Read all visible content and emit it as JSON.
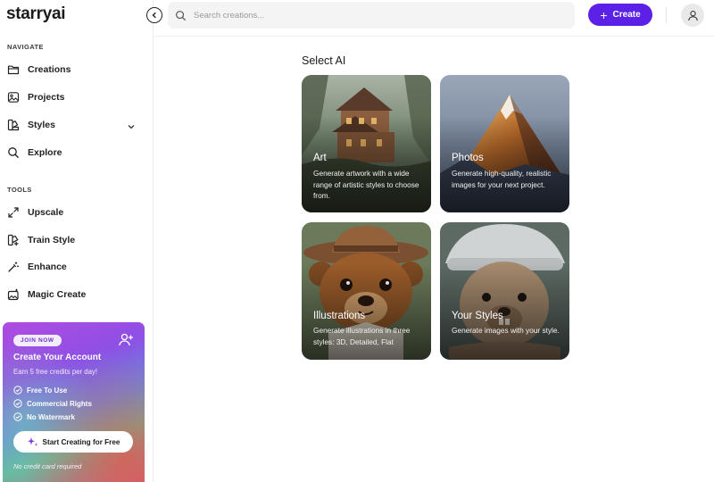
{
  "brand": {
    "logo": "starryai"
  },
  "sidebar": {
    "navigate_label": "NAVIGATE",
    "navigate_items": [
      {
        "label": "Creations",
        "icon": "folder-icon"
      },
      {
        "label": "Projects",
        "icon": "image-icon"
      },
      {
        "label": "Styles",
        "icon": "palette-icon"
      },
      {
        "label": "Explore",
        "icon": "search-icon"
      }
    ],
    "tools_label": "TOOLS",
    "tool_items": [
      {
        "label": "Upscale",
        "icon": "expand-icon"
      },
      {
        "label": "Train Style",
        "icon": "train-icon"
      },
      {
        "label": "Enhance",
        "icon": "wand-icon"
      },
      {
        "label": "Magic Create",
        "icon": "magic-image-icon"
      }
    ]
  },
  "promo": {
    "pill": "JOIN NOW",
    "title": "Create Your Account",
    "subtitle": "Earn 5 free credits per day!",
    "perks": [
      "Free To Use",
      "Commercial Rights",
      "No Watermark"
    ],
    "cta": "Start Creating for Free",
    "footnote": "No credit card required"
  },
  "topbar": {
    "search_placeholder": "Search creations...",
    "create_label": "Create"
  },
  "main": {
    "title": "Select AI",
    "cards": [
      {
        "title": "Art",
        "description": "Generate artwork with a wide range of artistic styles to choose from."
      },
      {
        "title": "Photos",
        "description": "Generate high-quality, realistic images for your next project."
      },
      {
        "title": "Illustrations",
        "description": "Generate illustrations in three styles: 3D, Detailed, Flat"
      },
      {
        "title": "Your Styles",
        "description": "Generate images with your style."
      }
    ]
  },
  "colors": {
    "accent": "#5b21e6",
    "promo_pill_text": "#6b33c9"
  }
}
